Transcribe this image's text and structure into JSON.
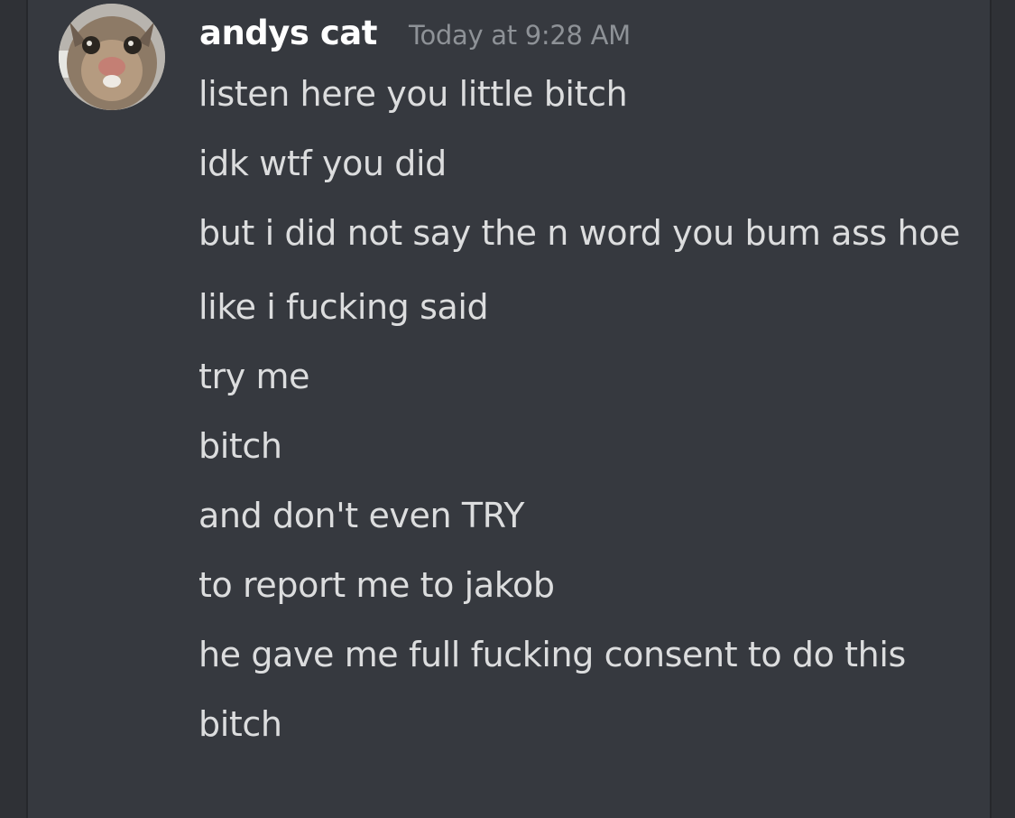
{
  "message_group": {
    "author": "andys cat",
    "timestamp": "Today at 9:28 AM",
    "messages": [
      "listen here you little bitch",
      "idk wtf you did",
      "but i did not say the n word you bum ass hoe",
      "like i fucking said",
      "try me",
      "bitch",
      "and don't even TRY",
      "to report me to jakob",
      "he gave me full fucking consent to do this",
      "bitch"
    ]
  },
  "colors": {
    "background": "#36393f",
    "sidebar": "#2f3136",
    "author": "#ffffff",
    "timestamp": "#8e9297",
    "message_text": "#dcddde"
  },
  "icons": {
    "avatar": "cat-avatar-icon"
  }
}
